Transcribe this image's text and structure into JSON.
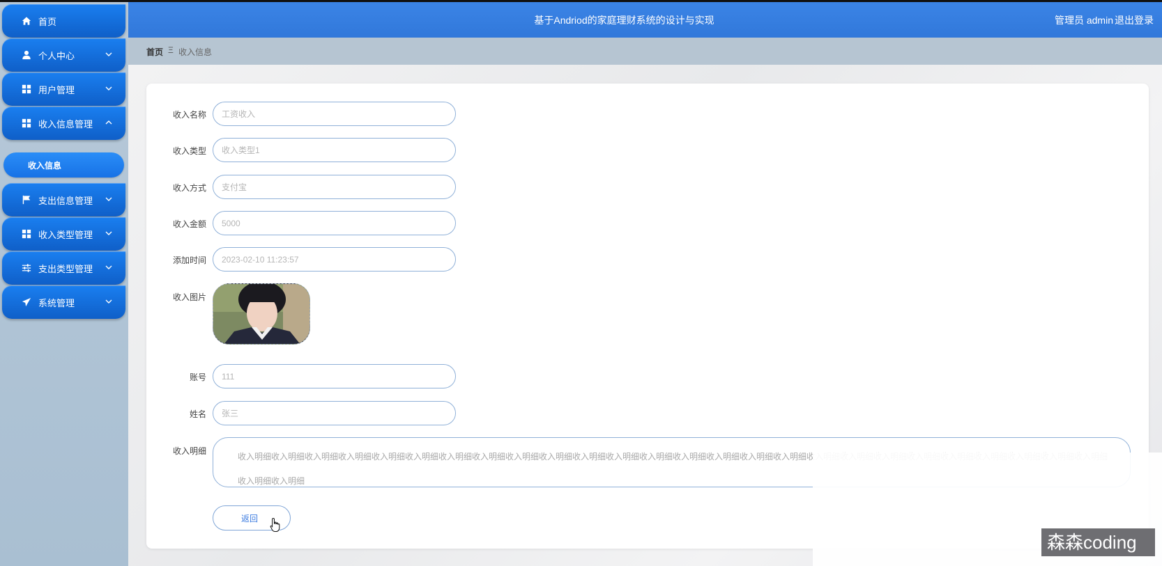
{
  "header": {
    "title": "基于Andriod的家庭理财系统的设计与实现",
    "user": "管理员 admin",
    "logout": "退出登录"
  },
  "sidebar": {
    "items": [
      {
        "label": "首页",
        "icon": "home-icon"
      },
      {
        "label": "个人中心",
        "icon": "user-icon"
      },
      {
        "label": "用户管理",
        "icon": "grid-icon"
      },
      {
        "label": "收入信息管理",
        "icon": "grid-icon"
      },
      {
        "label": "支出信息管理",
        "icon": "flag-icon"
      },
      {
        "label": "收入类型管理",
        "icon": "grid-icon"
      },
      {
        "label": "支出类型管理",
        "icon": "sliders-icon"
      },
      {
        "label": "系统管理",
        "icon": "send-icon"
      }
    ],
    "sub_active": "收入信息"
  },
  "breadcrumb": {
    "home": "首页",
    "separator": "Ξ",
    "current": "收入信息"
  },
  "form": {
    "fields": [
      {
        "label": "收入名称",
        "value": "工资收入"
      },
      {
        "label": "收入类型",
        "value": "收入类型1"
      },
      {
        "label": "收入方式",
        "value": "支付宝"
      },
      {
        "label": "收入金额",
        "value": "5000"
      },
      {
        "label": "添加时间",
        "value": "2023-02-10 11:23:57"
      }
    ],
    "image_label": "收入图片",
    "account_label": "账号",
    "account_value": "111",
    "name_label": "姓名",
    "name_value": "张三",
    "detail_label": "收入明细",
    "detail_value": "收入明细收入明细收入明细收入明细收入明细收入明细收入明细收入明细收入明细收入明细收入明细收入明细收入明细收入明细收入明细收入明细收入明细收入明细收入明细收入明细收入明细收入明细收入明细收入明细收入明细收入明细收入明细收入明细",
    "back_button": "返回"
  },
  "watermark": "森森coding"
}
